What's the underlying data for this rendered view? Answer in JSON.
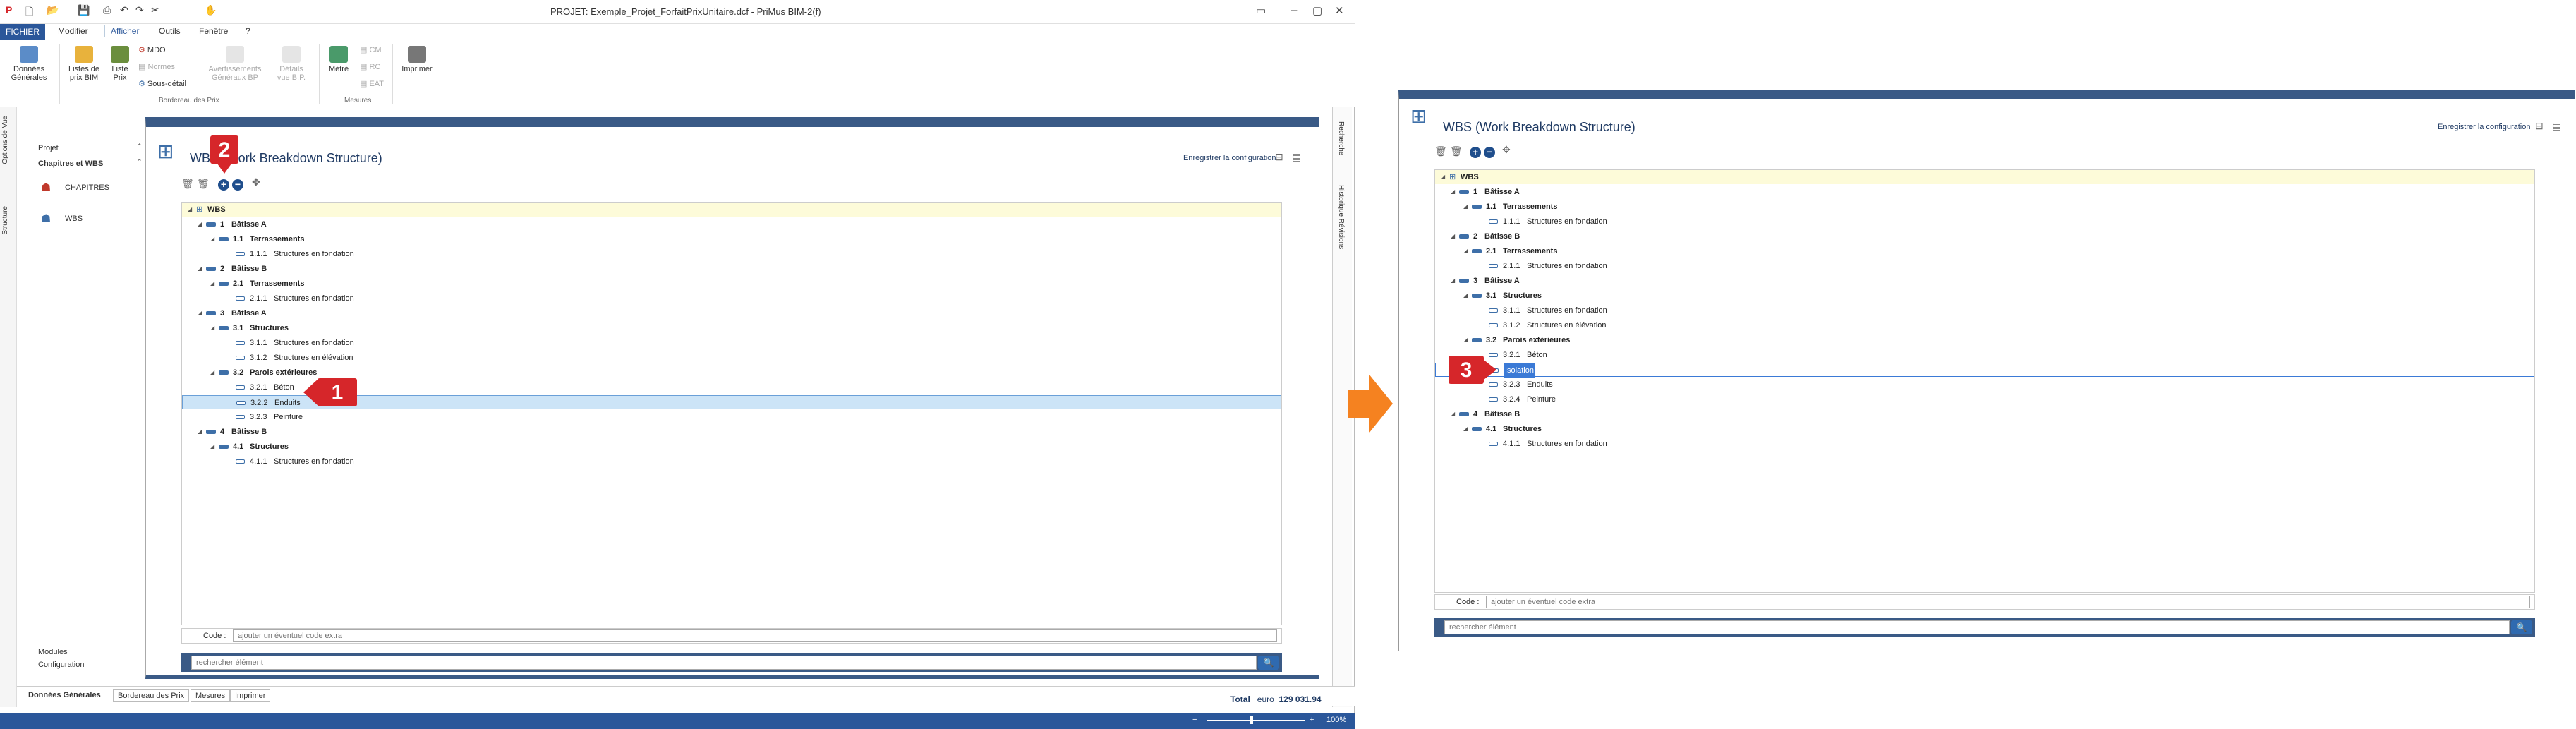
{
  "window": {
    "title": "PROJET: Exemple_Projet_ForfaitPrixUnitaire.dcf - PriMus  BIM-2(f)"
  },
  "menubar": {
    "fichier": "FICHIER",
    "items": [
      "Modifier",
      "Afficher",
      "Outils",
      "Fenêtre",
      "?"
    ]
  },
  "ribbon": {
    "donnees_generales": "Données Générales",
    "listes_prix_bim": "Listes de prix BIM",
    "liste_prix": "Liste Prix",
    "mdo": "MDO",
    "normes": "Normes",
    "sous_detail": "Sous-détail",
    "avertissements": "Avertissements Généraux BP",
    "details_vue": "Détails vue B.P.",
    "metre": "Métré",
    "cm": "CM",
    "rc": "RC",
    "eat": "EAT",
    "imprimer": "Imprimer",
    "group_bordereau": "Bordereau des Prix",
    "group_mesures": "Mesures"
  },
  "vtabs": {
    "options": "Options de Vue",
    "structure": "Structure"
  },
  "nav": {
    "projet": "Projet",
    "chapitres_wbs": "Chapitres et WBS",
    "chapitres": "CHAPITRES",
    "wbs": "WBS",
    "modules": "Modules",
    "configuration": "Configuration"
  },
  "right_pane": {
    "recherche": "Recherche",
    "historique": "Historique Révisions"
  },
  "wbs": {
    "title": "WBS (Work Breakdown Structure)",
    "save_config": "Enregistrer la configuration",
    "root": "WBS",
    "code_label": "Code :",
    "code_placeholder": "ajouter un éventuel code extra",
    "search_placeholder": "rechercher élément"
  },
  "tree_left": [
    {
      "num": "",
      "txt": "WBS",
      "level": 0,
      "kind": "root"
    },
    {
      "num": "1",
      "txt": "Bâtisse A",
      "level": 1,
      "kind": "bar"
    },
    {
      "num": "1.1",
      "txt": "Terrassements",
      "level": 2,
      "kind": "bar"
    },
    {
      "num": "1.1.1",
      "txt": "Structures en fondation",
      "level": 3,
      "kind": "leaf"
    },
    {
      "num": "2",
      "txt": "Bâtisse B",
      "level": 1,
      "kind": "bar"
    },
    {
      "num": "2.1",
      "txt": "Terrassements",
      "level": 2,
      "kind": "bar"
    },
    {
      "num": "2.1.1",
      "txt": "Structures en fondation",
      "level": 3,
      "kind": "leaf"
    },
    {
      "num": "3",
      "txt": "Bâtisse A",
      "level": 1,
      "kind": "bar"
    },
    {
      "num": "3.1",
      "txt": "Structures",
      "level": 2,
      "kind": "bar"
    },
    {
      "num": "3.1.1",
      "txt": "Structures en fondation",
      "level": 3,
      "kind": "leaf"
    },
    {
      "num": "3.1.2",
      "txt": "Structures en élévation",
      "level": 3,
      "kind": "leaf"
    },
    {
      "num": "3.2",
      "txt": "Parois extérieures",
      "level": 2,
      "kind": "bar"
    },
    {
      "num": "3.2.1",
      "txt": "Béton",
      "level": 3,
      "kind": "leaf"
    },
    {
      "num": "3.2.2",
      "txt": "Enduits",
      "level": 3,
      "kind": "leaf",
      "selected": true
    },
    {
      "num": "3.2.3",
      "txt": "Peinture",
      "level": 3,
      "kind": "leaf"
    },
    {
      "num": "4",
      "txt": "Bâtisse B",
      "level": 1,
      "kind": "bar"
    },
    {
      "num": "4.1",
      "txt": "Structures",
      "level": 2,
      "kind": "bar"
    },
    {
      "num": "4.1.1",
      "txt": "Structures en fondation",
      "level": 3,
      "kind": "leaf"
    }
  ],
  "tree_right": [
    {
      "num": "",
      "txt": "WBS",
      "level": 0,
      "kind": "root"
    },
    {
      "num": "1",
      "txt": "Bâtisse A",
      "level": 1,
      "kind": "bar"
    },
    {
      "num": "1.1",
      "txt": "Terrassements",
      "level": 2,
      "kind": "bar"
    },
    {
      "num": "1.1.1",
      "txt": "Structures en fondation",
      "level": 3,
      "kind": "leaf"
    },
    {
      "num": "2",
      "txt": "Bâtisse B",
      "level": 1,
      "kind": "bar"
    },
    {
      "num": "2.1",
      "txt": "Terrassements",
      "level": 2,
      "kind": "bar"
    },
    {
      "num": "2.1.1",
      "txt": "Structures en fondation",
      "level": 3,
      "kind": "leaf"
    },
    {
      "num": "3",
      "txt": "Bâtisse A",
      "level": 1,
      "kind": "bar"
    },
    {
      "num": "3.1",
      "txt": "Structures",
      "level": 2,
      "kind": "bar"
    },
    {
      "num": "3.1.1",
      "txt": "Structures en fondation",
      "level": 3,
      "kind": "leaf"
    },
    {
      "num": "3.1.2",
      "txt": "Structures en élévation",
      "level": 3,
      "kind": "leaf"
    },
    {
      "num": "3.2",
      "txt": "Parois extérieures",
      "level": 2,
      "kind": "bar"
    },
    {
      "num": "3.2.1",
      "txt": "Béton",
      "level": 3,
      "kind": "leaf"
    },
    {
      "num": "",
      "txt": "Isolation",
      "level": 3,
      "kind": "leaf",
      "editing": true
    },
    {
      "num": "3.2.3",
      "txt": "Enduits",
      "level": 3,
      "kind": "leaf"
    },
    {
      "num": "3.2.4",
      "txt": "Peinture",
      "level": 3,
      "kind": "leaf"
    },
    {
      "num": "4",
      "txt": "Bâtisse B",
      "level": 1,
      "kind": "bar"
    },
    {
      "num": "4.1",
      "txt": "Structures",
      "level": 2,
      "kind": "bar"
    },
    {
      "num": "4.1.1",
      "txt": "Structures en fondation",
      "level": 3,
      "kind": "leaf"
    }
  ],
  "badges": {
    "one": "1",
    "two": "2",
    "three": "3"
  },
  "bottom": {
    "active": "Données Générales",
    "tabs": [
      "Bordereau des Prix",
      "Mesures",
      "Imprimer"
    ],
    "total_label": "Total",
    "currency": "euro",
    "total_value": "129 031.94",
    "zoom": "100%"
  },
  "colors": {
    "brand": "#2b579a",
    "header": "#3a5a86",
    "badge": "#d6262a",
    "arrow": "#f58220",
    "selection": "#cce4f7"
  }
}
